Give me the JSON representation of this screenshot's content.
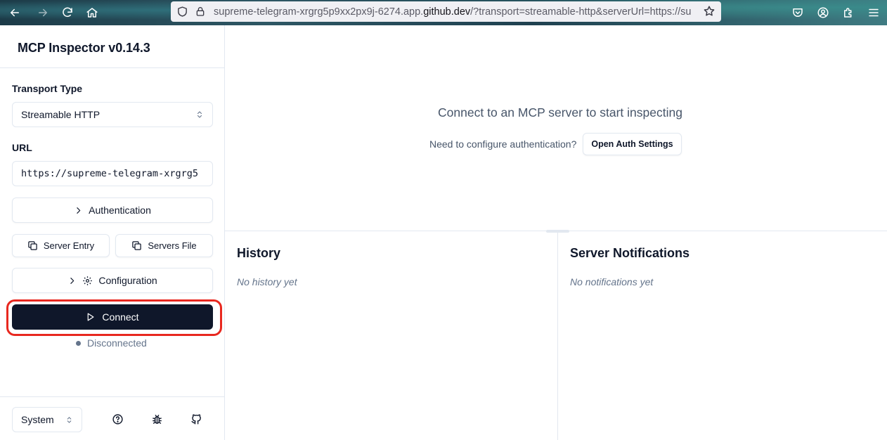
{
  "browser": {
    "url_prefix": "supreme-telegram-xrgrg5p9xx2px9j-6274.app.",
    "url_domain": "github.dev",
    "url_suffix": "/?transport=streamable-http&serverUrl=https://sup"
  },
  "sidebar": {
    "title": "MCP Inspector v0.14.3",
    "transport_label": "Transport Type",
    "transport_value": "Streamable HTTP",
    "url_label": "URL",
    "url_value": "https://supreme-telegram-xrgrg5",
    "authentication_label": "Authentication",
    "server_entry_label": "Server Entry",
    "servers_file_label": "Servers File",
    "configuration_label": "Configuration",
    "connect_label": "Connect",
    "status_text": "Disconnected",
    "theme_value": "System"
  },
  "main": {
    "connect_message": "Connect to an MCP server to start inspecting",
    "auth_question": "Need to configure authentication?",
    "auth_button_label": "Open Auth Settings",
    "history_title": "History",
    "history_empty": "No history yet",
    "notifications_title": "Server Notifications",
    "notifications_empty": "No notifications yet"
  },
  "colors": {
    "primary_button": "#0f172a",
    "highlight": "#e8281f",
    "muted_text": "#64748b",
    "border": "#e2e8f0"
  }
}
